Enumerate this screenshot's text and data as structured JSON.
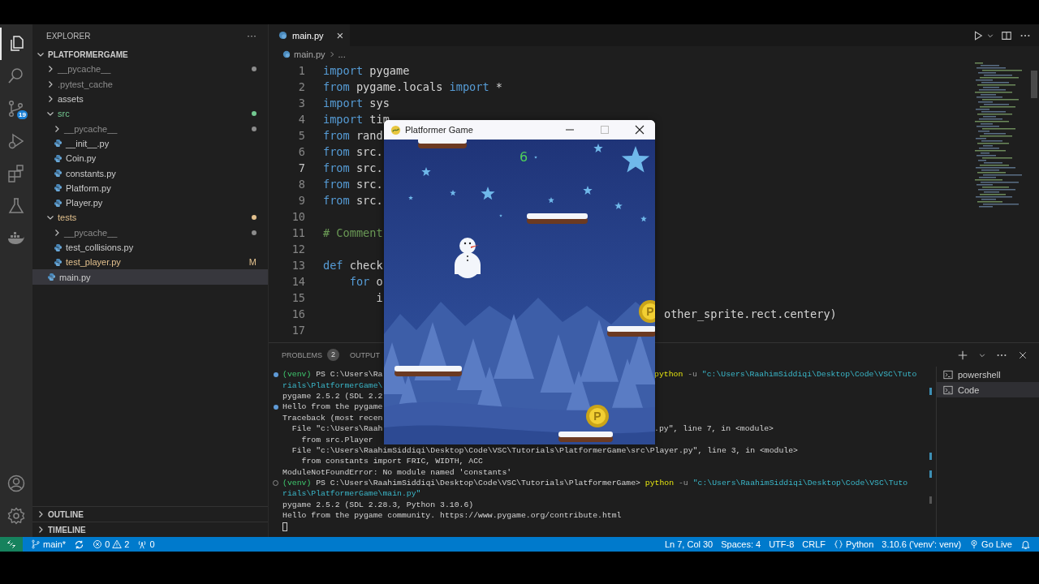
{
  "activity_bar": {
    "items": [
      {
        "kind": "explorer",
        "selected": true
      },
      {
        "kind": "search",
        "selected": false
      },
      {
        "kind": "source-control",
        "selected": false,
        "badge": "19"
      },
      {
        "kind": "run-debug",
        "selected": false
      },
      {
        "kind": "extensions",
        "selected": false
      },
      {
        "kind": "testing",
        "selected": false
      },
      {
        "kind": "docker",
        "selected": false
      }
    ],
    "bottom": [
      {
        "kind": "account"
      },
      {
        "kind": "settings"
      }
    ]
  },
  "sidebar": {
    "title": "EXPLORER",
    "more": "···",
    "tree": {
      "label": "PLATFORMERGAME",
      "expanded": true,
      "children": [
        {
          "label": "__pycache__",
          "kind": "folder",
          "expanded": false,
          "color": "#8c8c8c",
          "dot": true,
          "selected": false
        },
        {
          "label": ".pytest_cache",
          "kind": "folder",
          "expanded": false,
          "color": "#8c8c8c",
          "dot": false,
          "selected": false
        },
        {
          "label": "assets",
          "kind": "folder",
          "expanded": false,
          "color": "#cccccc",
          "dot": false,
          "selected": false
        },
        {
          "label": "src",
          "kind": "folder",
          "expanded": true,
          "color": "#73c991",
          "dot": true,
          "selected": false,
          "children": [
            {
              "label": "__pycache__",
              "kind": "folder",
              "expanded": false,
              "color": "#8c8c8c",
              "dot": true,
              "selected": false
            },
            {
              "label": "__init__.py",
              "kind": "file",
              "color": "#cccccc",
              "dot": false,
              "selected": false
            },
            {
              "label": "Coin.py",
              "kind": "file",
              "color": "#cccccc",
              "dot": false,
              "selected": false
            },
            {
              "label": "constants.py",
              "kind": "file",
              "color": "#cccccc",
              "dot": false,
              "selected": false
            },
            {
              "label": "Platform.py",
              "kind": "file",
              "color": "#cccccc",
              "dot": false,
              "selected": false
            },
            {
              "label": "Player.py",
              "kind": "file",
              "color": "#cccccc",
              "dot": false,
              "selected": false
            }
          ]
        },
        {
          "label": "tests",
          "kind": "folder",
          "expanded": true,
          "color": "#e2c08d",
          "dot": true,
          "selected": false,
          "children": [
            {
              "label": "__pycache__",
              "kind": "folder",
              "expanded": false,
              "color": "#8c8c8c",
              "dot": true,
              "selected": false
            },
            {
              "label": "test_collisions.py",
              "kind": "file",
              "color": "#cccccc",
              "dot": false,
              "selected": false
            },
            {
              "label": "test_player.py",
              "kind": "file",
              "color": "#e2c08d",
              "dot": false,
              "badge": "M",
              "selected": false
            }
          ]
        },
        {
          "label": "main.py",
          "kind": "file",
          "color": "#cccccc",
          "dot": false,
          "selected": true
        }
      ]
    },
    "sections": [
      {
        "label": "OUTLINE",
        "expanded": false
      },
      {
        "label": "TIMELINE",
        "expanded": false
      }
    ]
  },
  "editor": {
    "tabs": [
      {
        "label": "main.py",
        "selected": true,
        "close": "×"
      }
    ],
    "breadcrumbs": [
      "main.py",
      "..."
    ],
    "lines": [
      {
        "number": "1",
        "current": false,
        "tokens": [
          {
            "kind": "keyword",
            "text": "import"
          },
          {
            "kind": "plain",
            "text": " pygame"
          }
        ]
      },
      {
        "number": "2",
        "current": false,
        "tokens": [
          {
            "kind": "keyword",
            "text": "from"
          },
          {
            "kind": "plain",
            "text": " pygame.locals "
          },
          {
            "kind": "keyword",
            "text": "import"
          },
          {
            "kind": "plain",
            "text": " *"
          }
        ]
      },
      {
        "number": "3",
        "current": false,
        "tokens": [
          {
            "kind": "keyword",
            "text": "import"
          },
          {
            "kind": "plain",
            "text": " sys"
          }
        ]
      },
      {
        "number": "4",
        "current": false,
        "tokens": [
          {
            "kind": "keyword",
            "text": "import"
          },
          {
            "kind": "plain",
            "text": " tim"
          }
        ]
      },
      {
        "number": "5",
        "current": false,
        "tokens": [
          {
            "kind": "keyword",
            "text": "from"
          },
          {
            "kind": "plain",
            "text": " rand"
          }
        ]
      },
      {
        "number": "6",
        "current": false,
        "tokens": [
          {
            "kind": "keyword",
            "text": "from"
          },
          {
            "kind": "plain",
            "text": " src."
          }
        ]
      },
      {
        "number": "7",
        "current": true,
        "tokens": [
          {
            "kind": "keyword",
            "text": "from"
          },
          {
            "kind": "plain",
            "text": " src."
          }
        ]
      },
      {
        "number": "8",
        "current": false,
        "tokens": [
          {
            "kind": "keyword",
            "text": "from"
          },
          {
            "kind": "plain",
            "text": " src."
          }
        ]
      },
      {
        "number": "9",
        "current": false,
        "tokens": [
          {
            "kind": "keyword",
            "text": "from"
          },
          {
            "kind": "plain",
            "text": " src."
          }
        ]
      },
      {
        "number": "10",
        "current": false
      },
      {
        "number": "11",
        "current": false,
        "tokens": [
          {
            "kind": "comment",
            "text": "# Comment"
          }
        ]
      },
      {
        "number": "12",
        "current": false
      },
      {
        "number": "13",
        "current": false,
        "tokens": [
          {
            "kind": "keyword",
            "text": "def"
          },
          {
            "kind": "plain",
            "text": " check"
          }
        ]
      },
      {
        "number": "14",
        "current": false,
        "tokens": [
          {
            "kind": "keyword",
            "text": "    for"
          },
          {
            "kind": "plain",
            "text": " o"
          }
        ]
      },
      {
        "number": "15",
        "current": false,
        "tokens": [
          {
            "kind": "plain",
            "text": "        i"
          }
        ]
      },
      {
        "number": "16",
        "current": false,
        "tail": [
          {
            "kind": "plain",
            "text": "other_sprite.rect.centery)"
          }
        ]
      },
      {
        "number": "17",
        "current": false
      }
    ]
  },
  "panel": {
    "tabs": [
      {
        "label": "PROBLEMS",
        "selected": false,
        "badge": "2"
      },
      {
        "label": "OUTPUT",
        "selected": false
      }
    ],
    "terminal_lines": [
      {
        "kind": "ok",
        "tokens": [
          {
            "kind": "green",
            "text": "(venv)"
          },
          {
            "kind": "plain",
            "text": " PS C:\\Users\\Ra"
          }
        ],
        "tail": [
          {
            "kind": "yellow",
            "text": "python"
          },
          {
            "kind": "grey",
            "text": " -u "
          },
          {
            "kind": "cyan",
            "text": "\"c:\\Users\\RaahimSiddiqi\\Desktop\\Code\\VSC\\Tuto"
          }
        ]
      },
      {
        "kind": "output",
        "tokens": [
          {
            "kind": "cyan",
            "text": "rials\\PlatformerGame\\"
          }
        ]
      },
      {
        "kind": "output",
        "tokens": [
          {
            "kind": "plain",
            "text": "pygame 2.5.2 (SDL 2.2"
          }
        ]
      },
      {
        "kind": "ok",
        "tokens": [
          {
            "kind": "plain",
            "text": "Hello from the pygame"
          }
        ]
      },
      {
        "kind": "output",
        "tokens": [
          {
            "kind": "plain",
            "text": "Traceback (most recen"
          }
        ]
      },
      {
        "kind": "output",
        "tokens": [
          {
            "kind": "plain",
            "text": "  File \"c:\\Users\\Raah"
          }
        ],
        "tail": [
          {
            "kind": "plain",
            "text": ".py\", line 7, in <module>"
          }
        ]
      },
      {
        "kind": "output",
        "tokens": [
          {
            "kind": "plain",
            "text": "    from src.Player"
          }
        ]
      },
      {
        "kind": "output",
        "tokens": [
          {
            "kind": "plain",
            "text": "  File \"c:\\Users\\RaahimSiddiqi\\Desktop\\Code\\VSC\\Tutorials\\PlatformerGame\\src\\Player.py\", line 3, in <module>"
          }
        ]
      },
      {
        "kind": "output",
        "tokens": [
          {
            "kind": "plain",
            "text": "    from constants import FRIC, WIDTH, ACC"
          }
        ]
      },
      {
        "kind": "output",
        "tokens": [
          {
            "kind": "plain",
            "text": "ModuleNotFoundError: No module named 'constants'"
          }
        ]
      },
      {
        "kind": "pending",
        "tokens": [
          {
            "kind": "green",
            "text": "(venv)"
          },
          {
            "kind": "plain",
            "text": " PS C:\\Users\\RaahimSiddiqi\\Desktop\\Code\\VSC\\Tutorials\\PlatformerGame> "
          },
          {
            "kind": "yellow",
            "text": "python"
          },
          {
            "kind": "grey",
            "text": " -u "
          },
          {
            "kind": "cyan",
            "text": "\"c:\\Users\\RaahimSiddiqi\\Desktop\\Code\\VSC\\Tuto"
          }
        ]
      },
      {
        "kind": "output",
        "tokens": [
          {
            "kind": "cyan",
            "text": "rials\\PlatformerGame\\main.py\""
          }
        ]
      },
      {
        "kind": "output",
        "tokens": [
          {
            "kind": "plain",
            "text": "pygame 2.5.2 (SDL 2.28.3, Python 3.10.6)"
          }
        ]
      },
      {
        "kind": "output",
        "tokens": [
          {
            "kind": "plain",
            "text": "Hello from the pygame community. https://www.pygame.org/contribute.html"
          }
        ]
      },
      {
        "kind": "cursor"
      }
    ],
    "terminals": [
      {
        "label": "powershell",
        "selected": false
      },
      {
        "label": "Code",
        "selected": true
      }
    ]
  },
  "game_window": {
    "title": "Platformer Game",
    "score": "6",
    "coins": [
      {
        "label": "P"
      },
      {
        "label": "P"
      }
    ]
  },
  "status_bar": {
    "branch": "main*",
    "errors": "0",
    "warnings": "2",
    "ports": "0",
    "right": [
      {
        "kind": "text",
        "text": "Ln 7, Col 30"
      },
      {
        "kind": "text",
        "text": "Spaces: 4"
      },
      {
        "kind": "text",
        "text": "UTF-8"
      },
      {
        "kind": "text",
        "text": "CRLF"
      },
      {
        "kind": "language",
        "text": "Python"
      },
      {
        "kind": "text",
        "text": "3.10.6 ('venv': venv)"
      },
      {
        "kind": "live",
        "text": "Go Live"
      },
      {
        "kind": "bell"
      }
    ]
  }
}
